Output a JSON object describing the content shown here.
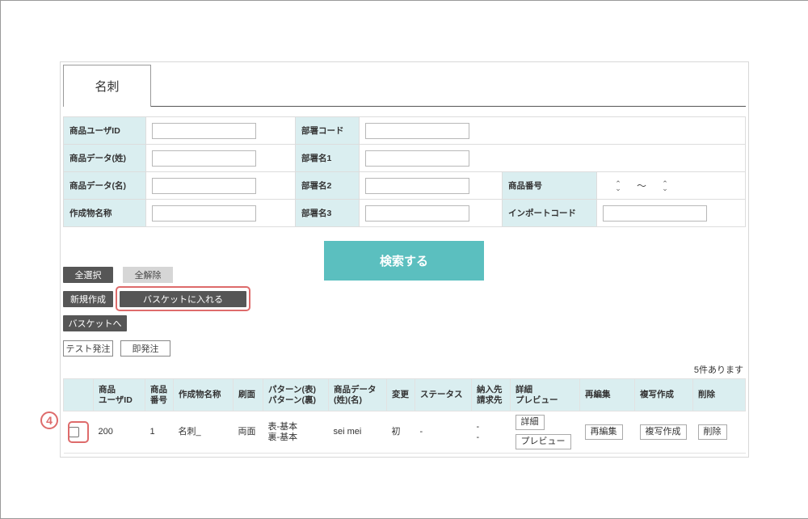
{
  "tab": {
    "label": "名刺"
  },
  "form": {
    "row1": {
      "label_a": "商品ユーザID",
      "label_b": "部署コード"
    },
    "row2": {
      "label_a": "商品データ(姓)",
      "label_b": "部署名1"
    },
    "row3": {
      "label_a": "商品データ(名)",
      "label_b": "部署名2",
      "label_c": "商品番号",
      "tilde": "〜"
    },
    "row4": {
      "label_a": "作成物名称",
      "label_b": "部署名3",
      "label_c": "インポートコード"
    }
  },
  "buttons": {
    "search": "検索する",
    "select_all": "全選択",
    "deselect_all": "全解除",
    "new": "新規作成",
    "add_basket": "バスケットに入れる",
    "to_basket": "バスケットへ",
    "test_order": "テスト発注",
    "instant_order": "即発注"
  },
  "results": {
    "count": "5件あります",
    "headers": {
      "user_id": [
        "商品",
        "ユーザID"
      ],
      "product_no": [
        "商品",
        "番号"
      ],
      "name": "作成物名称",
      "side": "刷面",
      "pattern": [
        "パターン(表)",
        "パターン(裏)"
      ],
      "data": [
        "商品データ",
        "(姓)(名)"
      ],
      "change": "変更",
      "status": "ステータス",
      "delivery": [
        "納入先",
        "請求先"
      ],
      "detail": [
        "詳細",
        "プレビュー"
      ],
      "reedit": "再編集",
      "copy": "複写作成",
      "delete": "削除"
    },
    "rows": [
      {
        "user_id": "200",
        "product_no": "1",
        "name": "名刺_",
        "side": "両面",
        "pattern": [
          "表-基本",
          "裏-基本"
        ],
        "data": "sei mei",
        "change": "初",
        "status": "-",
        "delivery": [
          "-",
          "-"
        ],
        "detail_btn": "詳細",
        "preview_btn": "プレビュー",
        "reedit_btn": "再編集",
        "copy_btn": "複写作成",
        "delete_btn": "削除"
      }
    ]
  },
  "annotation": {
    "step": "4"
  },
  "colors": {
    "accent": "#5bbfbf",
    "label_bg": "#daeef0",
    "highlight": "#de6b6b",
    "dark_button": "#565656"
  }
}
